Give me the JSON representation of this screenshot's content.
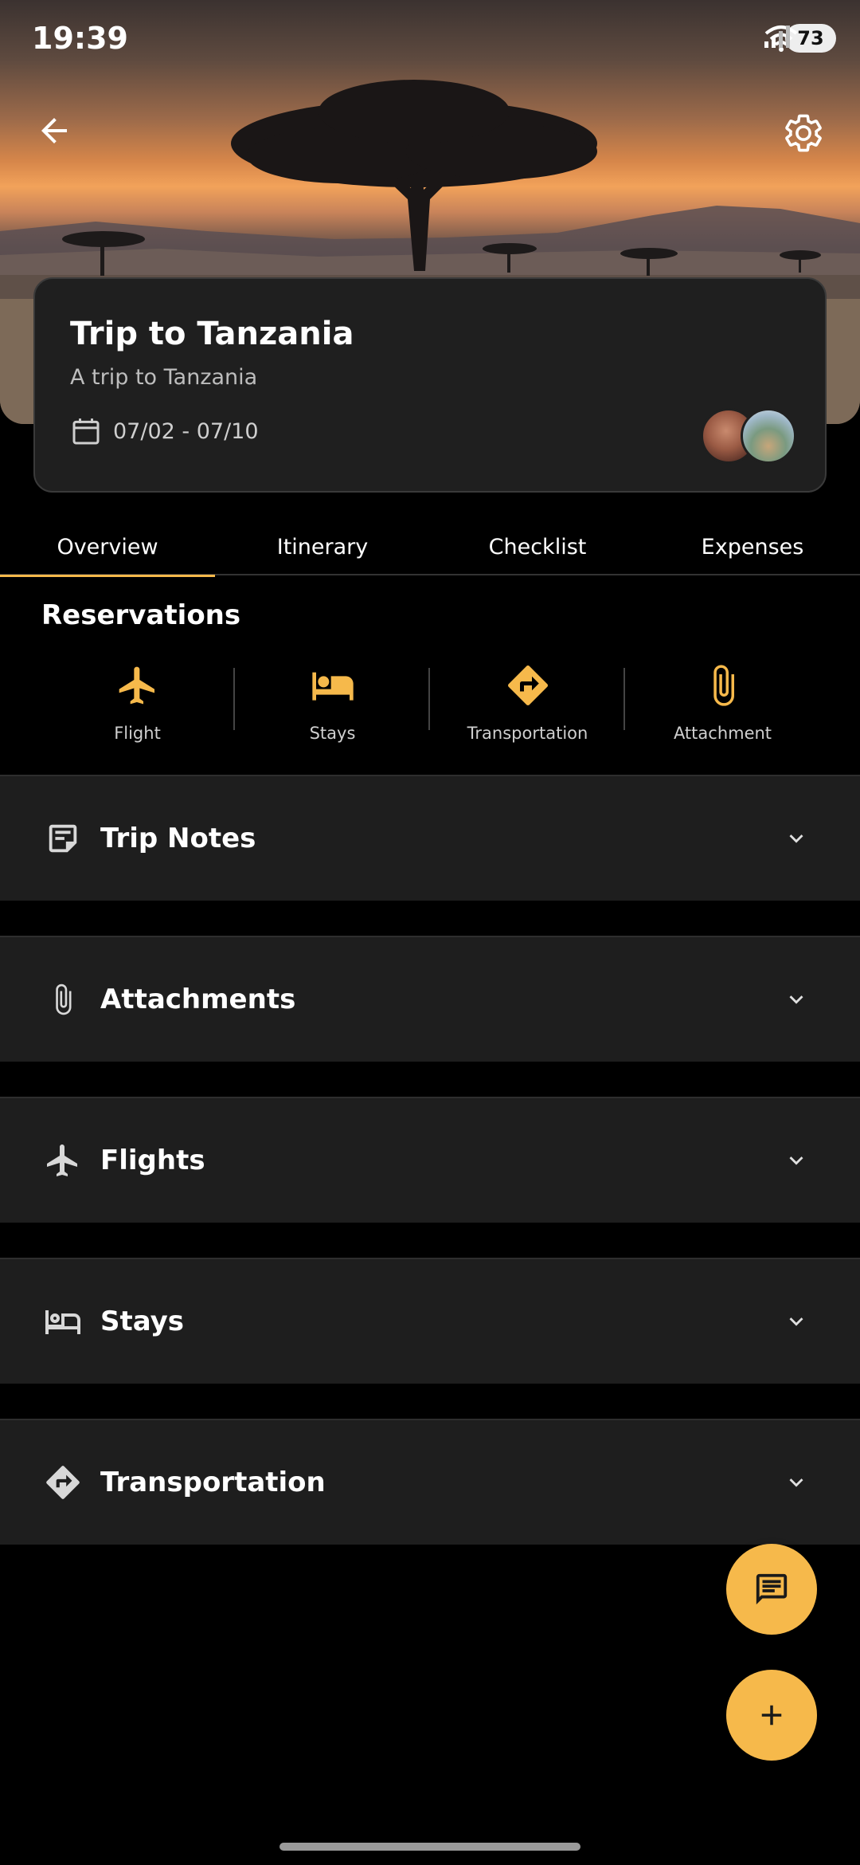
{
  "status_bar": {
    "time": "19:39",
    "battery": "73"
  },
  "trip": {
    "title": "Trip to Tanzania",
    "subtitle": "A trip to Tanzania",
    "dates": "07/02 - 07/10"
  },
  "tabs": [
    {
      "label": "Overview",
      "active": true
    },
    {
      "label": "Itinerary",
      "active": false
    },
    {
      "label": "Checklist",
      "active": false
    },
    {
      "label": "Expenses",
      "active": false
    }
  ],
  "reservations": {
    "title": "Reservations",
    "items": [
      {
        "label": "Flight",
        "icon": "airplane-icon"
      },
      {
        "label": "Stays",
        "icon": "bed-icon"
      },
      {
        "label": "Transportation",
        "icon": "directions-icon"
      },
      {
        "label": "Attachment",
        "icon": "paperclip-icon"
      }
    ]
  },
  "sections": [
    {
      "label": "Trip Notes",
      "icon": "notes-icon"
    },
    {
      "label": "Attachments",
      "icon": "paperclip-icon"
    },
    {
      "label": "Flights",
      "icon": "airplane-icon"
    },
    {
      "label": "Stays",
      "icon": "bed-icon"
    },
    {
      "label": "Transportation",
      "icon": "directions-icon"
    }
  ],
  "colors": {
    "accent": "#f6b94b",
    "card_bg": "#1f1f1f",
    "section_bg": "#1e1e1e",
    "background": "#000000"
  }
}
